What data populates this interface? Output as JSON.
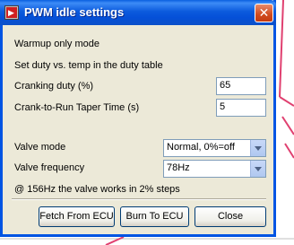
{
  "window": {
    "title": "PWM idle settings",
    "close_glyph": "✕"
  },
  "content": {
    "warmup_mode": "Warmup only mode",
    "duty_table_note": "Set duty vs. temp in the duty table",
    "cranking_duty_label": "Cranking duty (%)",
    "cranking_duty_value": "65",
    "taper_time_label": "Crank-to-Run Taper Time (s)",
    "taper_time_value": "5",
    "valve_mode_label": "Valve mode",
    "valve_mode_value": "Normal, 0%=off",
    "valve_frequency_label": "Valve frequency",
    "valve_frequency_value": "78Hz",
    "frequency_note": "@ 156Hz the valve works in 2% steps"
  },
  "buttons": {
    "fetch": "Fetch From ECU",
    "burn": "Burn To ECU",
    "close": "Close"
  },
  "icons": {
    "app": "app-icon",
    "close": "close-icon",
    "dropdown": "chevron-down-icon"
  },
  "colors": {
    "titlebar": "#0054e3",
    "dialog_bg": "#ece9d8",
    "close_button": "#d04a1e"
  }
}
